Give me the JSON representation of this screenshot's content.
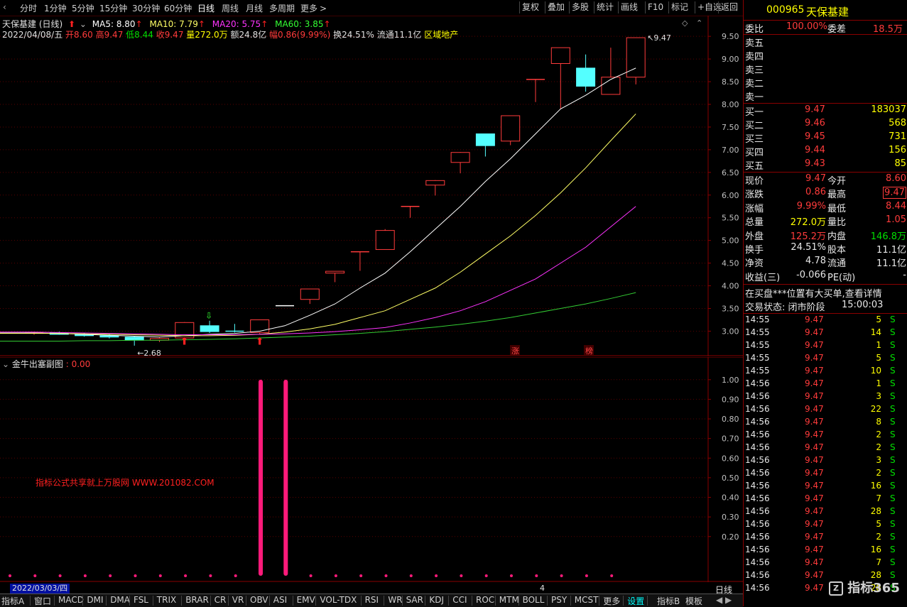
{
  "toolbar": {
    "periods": [
      "分时",
      "1分钟",
      "5分钟",
      "15分钟",
      "30分钟",
      "60分钟",
      "日线",
      "周线",
      "月线",
      "多周期",
      "更多"
    ],
    "active_period": "日线",
    "right_buttons": [
      "复权",
      "叠加",
      "多股",
      "统计",
      "画线",
      "F10",
      "标记",
      "+自选",
      "返回"
    ]
  },
  "main_chart": {
    "title": "天保基建 (日线)",
    "ma5": "MA5: 8.80",
    "ma10": "MA10: 7.79",
    "ma20": "MA20: 5.75",
    "ma60": "MA60: 3.85",
    "info_date": "2022/04/08/五",
    "info_open": "开8.60",
    "info_high": "高9.47",
    "info_low": "低8.44",
    "info_close": "收9.47",
    "info_vol": "量272.0万",
    "info_amount": "额24.8亿",
    "info_change": "幅0.86(9.99%)",
    "info_turnover": "换24.51%",
    "info_float": "流通11.1亿",
    "info_sector": "区域地产",
    "y_ticks": [
      "9.50",
      "9.00",
      "8.50",
      "8.00",
      "7.50",
      "7.00",
      "6.50",
      "6.00",
      "5.50",
      "5.00",
      "4.50",
      "4.00",
      "3.50",
      "3.00"
    ],
    "high_label": "9.47",
    "low_label": "2.68",
    "zhang_label": "涨",
    "bang_label": "榜",
    "colors": {
      "up": "#ff3b3b",
      "down": "#54ffff",
      "ma5": "#ffffff",
      "ma10": "#ffff66",
      "ma20": "#ff33ff",
      "ma60": "#33cc33"
    }
  },
  "sub_chart": {
    "title": "金牛出塞副图",
    "value": ": 0.00",
    "y_ticks": [
      "1.00",
      "0.90",
      "0.80",
      "0.70",
      "0.60",
      "0.50",
      "0.40",
      "0.30",
      "0.20"
    ],
    "watermark": "指标公式共享就上万股网 WWW.201082.COM"
  },
  "date_footer": {
    "date": "2022/03/03/四",
    "marker": "4",
    "period": "日线"
  },
  "bottom_tabs": [
    "指标A",
    "窗口",
    "MACD",
    "DMI",
    "DMA",
    "FSL",
    "TRIX",
    "BRAR",
    "CR",
    "VR",
    "OBV",
    "ASI",
    "EMV",
    "VOL-TDX",
    "RSI",
    "WR",
    "SAR",
    "KDJ",
    "CCI",
    "ROC",
    "MTM",
    "BOLL",
    "PSY",
    "MCST",
    "更多",
    "设置"
  ],
  "bottom_right_tabs": [
    "指标B",
    "模板"
  ],
  "quote_panel": {
    "code": "000965",
    "name": "天保基建",
    "weibi_label": "委比",
    "weibi": "100.00%",
    "weicha_label": "委差",
    "weicha": "18.5万",
    "sell": [
      {
        "label": "卖五"
      },
      {
        "label": "卖四"
      },
      {
        "label": "卖三"
      },
      {
        "label": "卖二"
      },
      {
        "label": "卖一"
      }
    ],
    "buy": [
      {
        "label": "买一",
        "price": "9.47",
        "vol": "183037"
      },
      {
        "label": "买二",
        "price": "9.46",
        "vol": "568"
      },
      {
        "label": "买三",
        "price": "9.45",
        "vol": "731"
      },
      {
        "label": "买四",
        "price": "9.44",
        "vol": "156"
      },
      {
        "label": "买五",
        "price": "9.43",
        "vol": "85"
      }
    ],
    "stats": [
      {
        "l1": "现价",
        "v1": "9.47",
        "l2": "今开",
        "v2": "8.60"
      },
      {
        "l1": "涨跌",
        "v1": "0.86",
        "l2": "最高",
        "v2": "9.47"
      },
      {
        "l1": "涨幅",
        "v1": "9.99%",
        "l2": "最低",
        "v2": "8.44"
      },
      {
        "l1": "总量",
        "v1": "272.0万",
        "l2": "量比",
        "v2": "1.05"
      },
      {
        "l1": "外盘",
        "v1": "125.2万",
        "l2": "内盘",
        "v2": "146.8万"
      },
      {
        "l1": "换手",
        "v1": "24.51%",
        "l2": "股本",
        "v2": "11.1亿"
      },
      {
        "l1": "净资",
        "v1": "4.78",
        "l2": "流通",
        "v2": "11.1亿"
      },
      {
        "l1": "收益(三)",
        "v1": "-0.066",
        "l2": "PE(动)",
        "v2": "-"
      }
    ],
    "notice": "在买盘***位置有大买单,查看详情",
    "status_label": "交易状态: 闭市阶段",
    "status_time": "15:00:03",
    "ticks": [
      {
        "t": "14:55",
        "p": "9.47",
        "v": "5",
        "s": "S"
      },
      {
        "t": "14:55",
        "p": "9.47",
        "v": "14",
        "s": "S"
      },
      {
        "t": "14:55",
        "p": "9.47",
        "v": "1",
        "s": "S"
      },
      {
        "t": "14:55",
        "p": "9.47",
        "v": "5",
        "s": "S"
      },
      {
        "t": "14:55",
        "p": "9.47",
        "v": "10",
        "s": "S"
      },
      {
        "t": "14:56",
        "p": "9.47",
        "v": "1",
        "s": "S"
      },
      {
        "t": "14:56",
        "p": "9.47",
        "v": "3",
        "s": "S"
      },
      {
        "t": "14:56",
        "p": "9.47",
        "v": "22",
        "s": "S"
      },
      {
        "t": "14:56",
        "p": "9.47",
        "v": "8",
        "s": "S"
      },
      {
        "t": "14:56",
        "p": "9.47",
        "v": "2",
        "s": "S"
      },
      {
        "t": "14:56",
        "p": "9.47",
        "v": "2",
        "s": "S"
      },
      {
        "t": "14:56",
        "p": "9.47",
        "v": "3",
        "s": "S"
      },
      {
        "t": "14:56",
        "p": "9.47",
        "v": "2",
        "s": "S"
      },
      {
        "t": "14:56",
        "p": "9.47",
        "v": "16",
        "s": "S"
      },
      {
        "t": "14:56",
        "p": "9.47",
        "v": "7",
        "s": "S"
      },
      {
        "t": "14:56",
        "p": "9.47",
        "v": "28",
        "s": "S"
      },
      {
        "t": "14:56",
        "p": "9.47",
        "v": "5",
        "s": "S"
      },
      {
        "t": "14:56",
        "p": "9.47",
        "v": "2",
        "s": "S"
      },
      {
        "t": "14:56",
        "p": "9.47",
        "v": "16",
        "s": "S"
      },
      {
        "t": "14:56",
        "p": "9.47",
        "v": "7",
        "s": "S"
      },
      {
        "t": "14:56",
        "p": "9.47",
        "v": "28",
        "s": "S"
      },
      {
        "t": "14:56",
        "p": "9.47",
        "v": "28",
        "s": "S"
      }
    ],
    "logo": "指标365"
  },
  "chart_data": [
    {
      "type": "candlestick",
      "title": "天保基建 (日线)",
      "ylim": [
        2.6,
        9.8
      ],
      "candles": [
        {
          "o": 2.95,
          "h": 2.98,
          "l": 2.92,
          "c": 2.96
        },
        {
          "o": 2.96,
          "h": 2.99,
          "l": 2.92,
          "c": 2.93
        },
        {
          "o": 2.93,
          "h": 2.96,
          "l": 2.88,
          "c": 2.9
        },
        {
          "o": 2.9,
          "h": 2.94,
          "l": 2.84,
          "c": 2.87
        },
        {
          "o": 2.87,
          "h": 2.89,
          "l": 2.68,
          "c": 2.8
        },
        {
          "o": 2.8,
          "h": 2.86,
          "l": 2.76,
          "c": 2.84
        },
        {
          "o": 2.85,
          "h": 3.2,
          "l": 2.83,
          "c": 3.19
        },
        {
          "o": 3.12,
          "h": 3.23,
          "l": 2.96,
          "c": 2.99
        },
        {
          "o": 3.0,
          "h": 3.16,
          "l": 2.97,
          "c": 2.98
        },
        {
          "o": 2.97,
          "h": 3.22,
          "l": 2.94,
          "c": 3.25
        },
        {
          "o": 3.55,
          "h": 3.56,
          "l": 3.55,
          "c": 3.56
        },
        {
          "o": 3.7,
          "h": 3.93,
          "l": 3.6,
          "c": 3.93
        },
        {
          "o": 4.28,
          "h": 4.32,
          "l": 4.08,
          "c": 4.32
        },
        {
          "o": 4.75,
          "h": 4.75,
          "l": 4.33,
          "c": 4.75
        },
        {
          "o": 4.8,
          "h": 5.25,
          "l": 4.8,
          "c": 5.22
        },
        {
          "o": 5.74,
          "h": 5.75,
          "l": 5.5,
          "c": 5.75
        },
        {
          "o": 6.22,
          "h": 6.33,
          "l": 5.99,
          "c": 6.32
        },
        {
          "o": 6.72,
          "h": 6.95,
          "l": 6.48,
          "c": 6.94
        },
        {
          "o": 7.35,
          "h": 7.35,
          "l": 6.85,
          "c": 7.09
        },
        {
          "o": 7.19,
          "h": 7.75,
          "l": 7.1,
          "c": 7.75
        },
        {
          "o": 8.55,
          "h": 8.55,
          "l": 8.05,
          "c": 8.55
        },
        {
          "o": 8.9,
          "h": 9.2,
          "l": 7.9,
          "c": 9.25
        },
        {
          "o": 8.8,
          "h": 9.1,
          "l": 8.28,
          "c": 8.4
        },
        {
          "o": 8.22,
          "h": 9.25,
          "l": 8.22,
          "c": 8.6
        },
        {
          "o": 8.6,
          "h": 9.47,
          "l": 8.44,
          "c": 9.47
        }
      ],
      "ma5": [
        2.96,
        2.95,
        2.93,
        2.91,
        2.89,
        2.87,
        2.9,
        2.93,
        2.95,
        3.0,
        3.12,
        3.35,
        3.6,
        3.95,
        4.28,
        4.75,
        5.25,
        5.75,
        6.3,
        6.8,
        7.35,
        7.9,
        8.2,
        8.55,
        8.8
      ],
      "ma10": [
        2.95,
        2.95,
        2.94,
        2.93,
        2.92,
        2.91,
        2.9,
        2.9,
        2.91,
        2.93,
        2.98,
        3.05,
        3.15,
        3.3,
        3.45,
        3.7,
        3.95,
        4.3,
        4.7,
        5.1,
        5.55,
        6.05,
        6.6,
        7.2,
        7.79
      ],
      "ma20": [
        2.98,
        2.97,
        2.96,
        2.95,
        2.94,
        2.93,
        2.92,
        2.92,
        2.92,
        2.93,
        2.94,
        2.96,
        2.99,
        3.03,
        3.08,
        3.18,
        3.3,
        3.45,
        3.65,
        3.9,
        4.15,
        4.5,
        4.85,
        5.3,
        5.75
      ],
      "ma60": [
        2.78,
        2.78,
        2.79,
        2.79,
        2.8,
        2.8,
        2.81,
        2.82,
        2.83,
        2.85,
        2.87,
        2.89,
        2.92,
        2.95,
        2.99,
        3.04,
        3.09,
        3.15,
        3.22,
        3.3,
        3.4,
        3.5,
        3.6,
        3.72,
        3.85
      ]
    },
    {
      "type": "bar",
      "title": "金牛出塞副图",
      "ylim": [
        0,
        1.05
      ],
      "values": [
        0,
        0,
        0,
        0,
        0,
        0,
        0,
        0,
        0,
        0,
        1,
        1,
        0,
        0,
        0,
        0,
        0,
        0,
        0,
        0,
        0,
        0,
        0,
        0,
        0
      ]
    }
  ]
}
